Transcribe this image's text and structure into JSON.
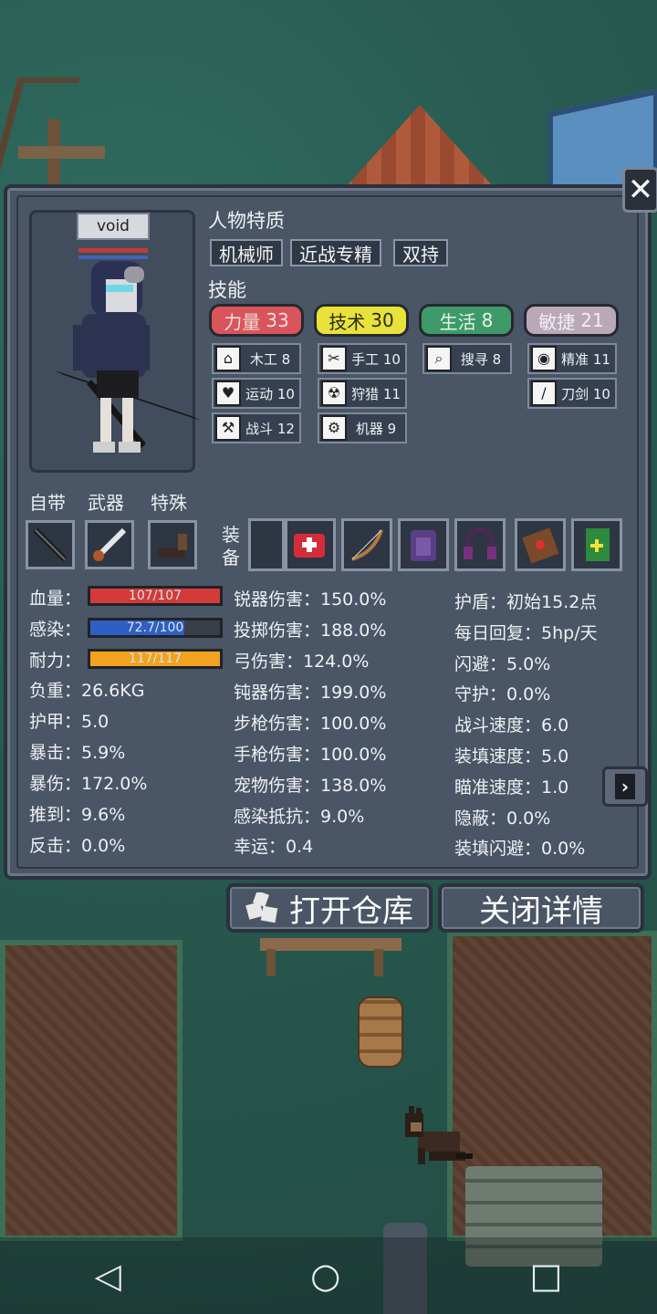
{
  "character": {
    "name": "void",
    "traits_title": "人物特质",
    "traits": [
      "机械师",
      "近战专精",
      "双持"
    ],
    "skills_title": "技能"
  },
  "attributes": [
    {
      "label": "力量",
      "value": "33",
      "color": "#d9545b",
      "text_color": "#f8e1e1"
    },
    {
      "label": "技术",
      "value": "30",
      "color": "#e8e23a",
      "text_color": "#2a2a10"
    },
    {
      "label": "生活",
      "value": "8",
      "color": "#3f9a6a",
      "text_color": "#e3f5ea"
    },
    {
      "label": "敏捷",
      "value": "21",
      "color": "#b8a8b8",
      "text_color": "#f3eef3"
    }
  ],
  "skills": {
    "col1": [
      {
        "icon": "house-icon",
        "glyph": "⌂",
        "label": "木工 8"
      },
      {
        "icon": "heart-icon",
        "glyph": "♥",
        "label": "运动 10"
      },
      {
        "icon": "axe-icon",
        "glyph": "⚒",
        "label": "战斗 12"
      }
    ],
    "col2": [
      {
        "icon": "scissors-icon",
        "glyph": "✂",
        "label": "手工 10"
      },
      {
        "icon": "radiation-icon",
        "glyph": "☢",
        "label": "狩猎 11"
      },
      {
        "icon": "gear-icon",
        "glyph": "⚙",
        "label": "机器 9"
      }
    ],
    "col3": [
      {
        "icon": "magnifier-icon",
        "glyph": "⌕",
        "label": "搜寻 8"
      }
    ],
    "col4": [
      {
        "icon": "eye-icon",
        "glyph": "◉",
        "label": "精准 11"
      },
      {
        "icon": "sword-icon",
        "glyph": "/",
        "label": "刀剑 10"
      }
    ]
  },
  "slots": {
    "builtin_label": "自带",
    "weapon_label": "武器",
    "special_label": "特殊",
    "equip_label": "装备"
  },
  "stats_col1": {
    "hp_label": "血量：",
    "hp_value": "107/107",
    "hp_fraction": 1.0,
    "infection_label": "感染：",
    "infection_value": "72.7/100",
    "infection_fraction": 0.727,
    "stamina_label": "耐力：",
    "stamina_value": "117/117",
    "stamina_fraction": 1.0,
    "rows": [
      "负重：26.6KG",
      "护甲：5.0",
      "暴击：5.9%",
      "暴伤：172.0%",
      "推到：9.6%",
      "反击：0.0%"
    ]
  },
  "stats_col2": [
    "锐器伤害：150.0%",
    "投掷伤害：188.0%",
    "弓伤害：124.0%",
    "钝器伤害：199.0%",
    "步枪伤害：100.0%",
    "手枪伤害：100.0%",
    "宠物伤害：138.0%",
    "感染抵抗：9.0%",
    "幸运：0.4"
  ],
  "stats_col3": [
    "护盾：初始15.2点",
    "每日回复：5hp/天",
    "闪避：5.0%",
    "守护：0.0%",
    "战斗速度：6.0",
    "装填速度：5.0",
    "瞄准速度：1.0",
    "隐蔽：0.0%",
    "装填闪避：0.0%"
  ],
  "buttons": {
    "open_storage": "打开仓库",
    "close_details": "关闭详情"
  },
  "colors": {
    "hp": "#d43a3a",
    "infection": "#2f5fc4",
    "stamina": "#f2a21e"
  }
}
